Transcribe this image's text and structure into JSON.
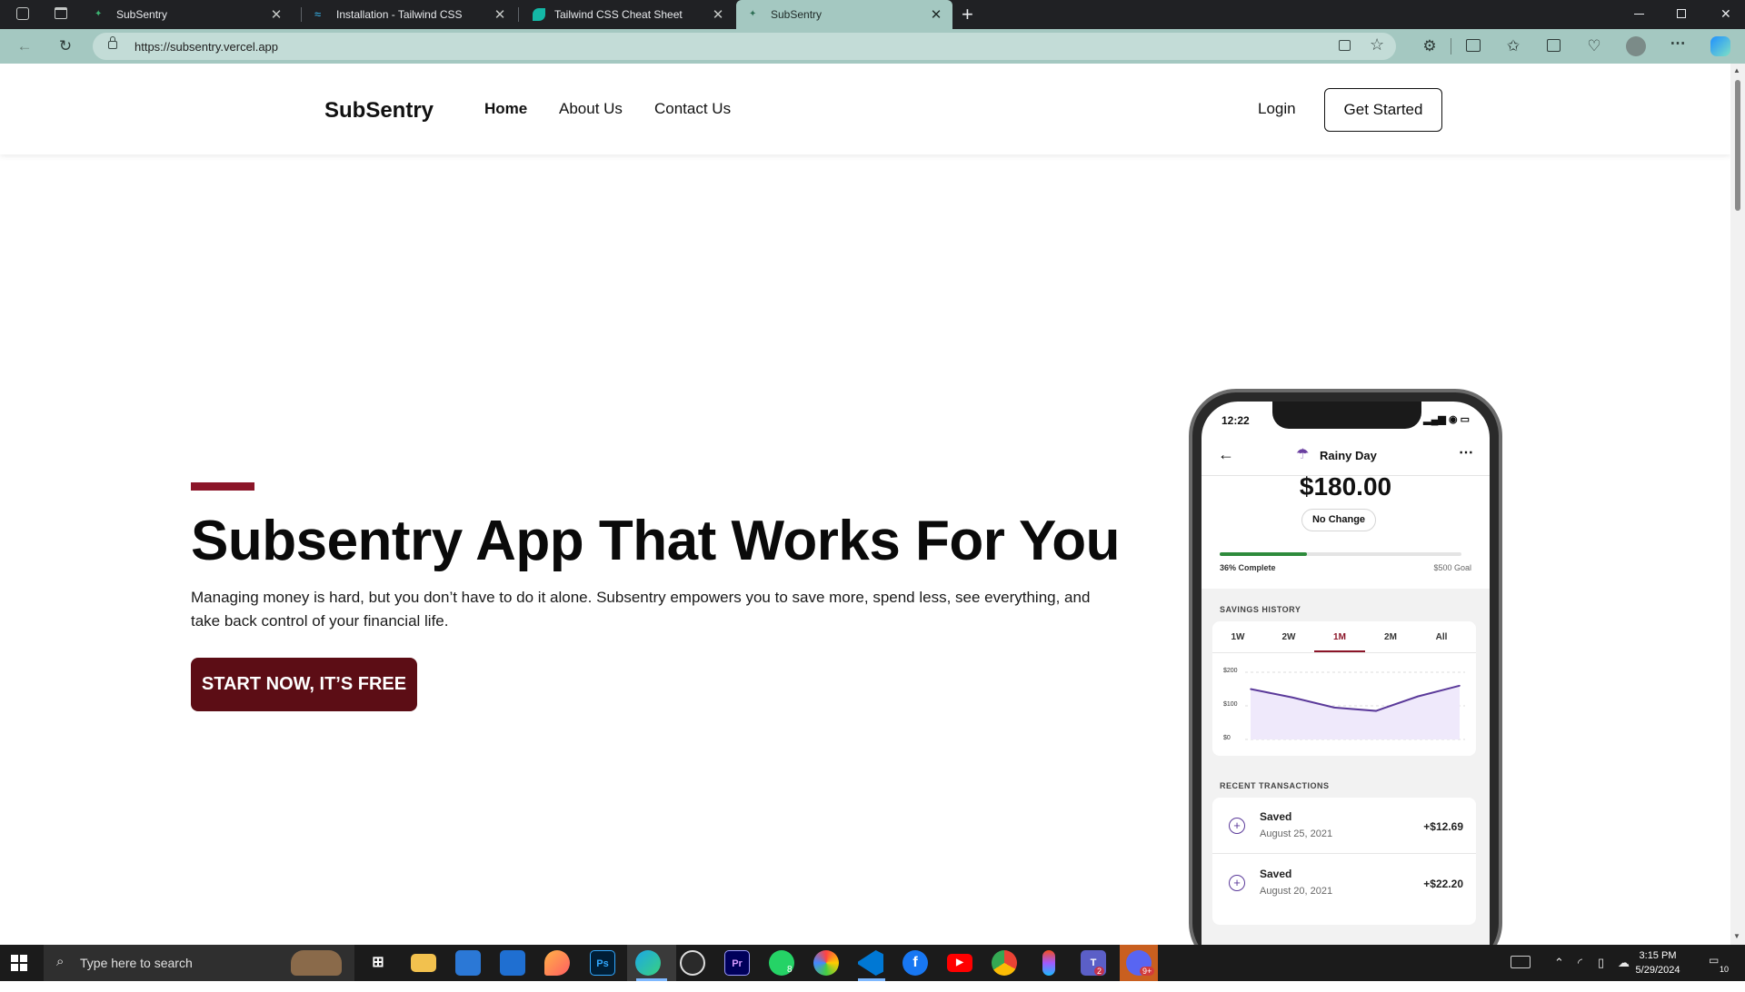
{
  "browser": {
    "tabs": [
      {
        "title": "SubSentry",
        "active": false
      },
      {
        "title": "Installation - Tailwind CSS",
        "active": false
      },
      {
        "title": "Tailwind CSS Cheat Sheet",
        "active": false
      },
      {
        "title": "SubSentry",
        "active": true
      }
    ],
    "new_tab_label": "+",
    "url": "https://subsentry.vercel.app",
    "accent_color": "#a4c8c1"
  },
  "site": {
    "brand": "SubSentry",
    "nav": [
      "Home",
      "About Us",
      "Contact Us"
    ],
    "login": "Login",
    "get_started": "Get Started"
  },
  "hero": {
    "title": "Subsentry App That Works For You",
    "description": "Managing money is hard, but you don’t have to do it alone. Subsentry empowers you to save more, spend less, see everything, and take back control of your financial life.",
    "cta": "START NOW, IT’S FREE",
    "accent_color": "#8b1528",
    "cta_color": "#5c0d15"
  },
  "phone": {
    "time": "12:22",
    "title": "Rainy Day",
    "amount": "$180.00",
    "change": "No Change",
    "progress_pct": 36,
    "progress_label": "36% Complete",
    "goal_label": "$500 Goal",
    "savings_history_label": "SAVINGS HISTORY",
    "ranges": [
      "1W",
      "2W",
      "1M",
      "2M",
      "All"
    ],
    "selected_range": "1M",
    "y_ticks": [
      "$200",
      "$100",
      "$0"
    ],
    "recent_label": "RECENT TRANSACTIONS",
    "transactions": [
      {
        "label": "Saved",
        "date": "August 25, 2021",
        "amount": "+$12.69"
      },
      {
        "label": "Saved",
        "date": "August 20, 2021",
        "amount": "+$22.20"
      }
    ]
  },
  "chart_data": {
    "type": "area",
    "x": [
      1,
      2,
      3,
      4,
      5,
      6
    ],
    "values": [
      150,
      125,
      95,
      85,
      128,
      160
    ],
    "ylim": [
      0,
      200
    ],
    "y_ticks": [
      "$200",
      "$100",
      "$0"
    ],
    "color": "#5b3a9a"
  },
  "taskbar": {
    "search_placeholder": "Type here to search",
    "time": "3:15 PM",
    "date": "5/29/2024",
    "notification_count": "10",
    "whatsapp_badge": "8",
    "teams_badge": "2",
    "discord_badge": "9+"
  }
}
